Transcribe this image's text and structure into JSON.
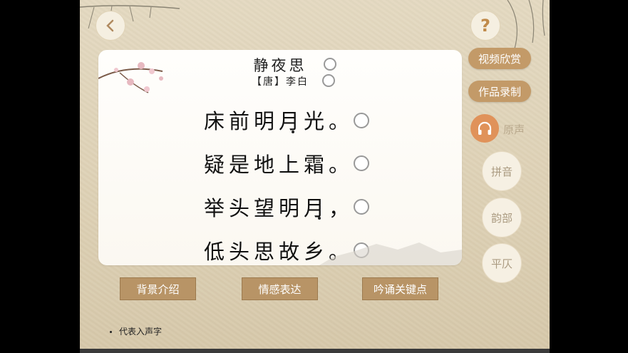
{
  "poem": {
    "title": "静夜思",
    "author": "【唐】李白",
    "lines": [
      "床前明月光。",
      "疑是地上霜。",
      "举头望明月，",
      "低头思故乡。"
    ]
  },
  "side_buttons": {
    "video": "视频欣赏",
    "record": "作品录制",
    "original_voice": "原声",
    "pinyin": "拼音",
    "rhyme": "韵部",
    "tone": "平仄"
  },
  "bottom_buttons": {
    "background": "背景介绍",
    "emotion": "情感表达",
    "recite": "吟诵关键点"
  },
  "help_label": "?",
  "legend": "代表入声字",
  "colors": {
    "accent": "#c39a68",
    "audio": "#e0925a",
    "paper": "#e4d9c1"
  }
}
